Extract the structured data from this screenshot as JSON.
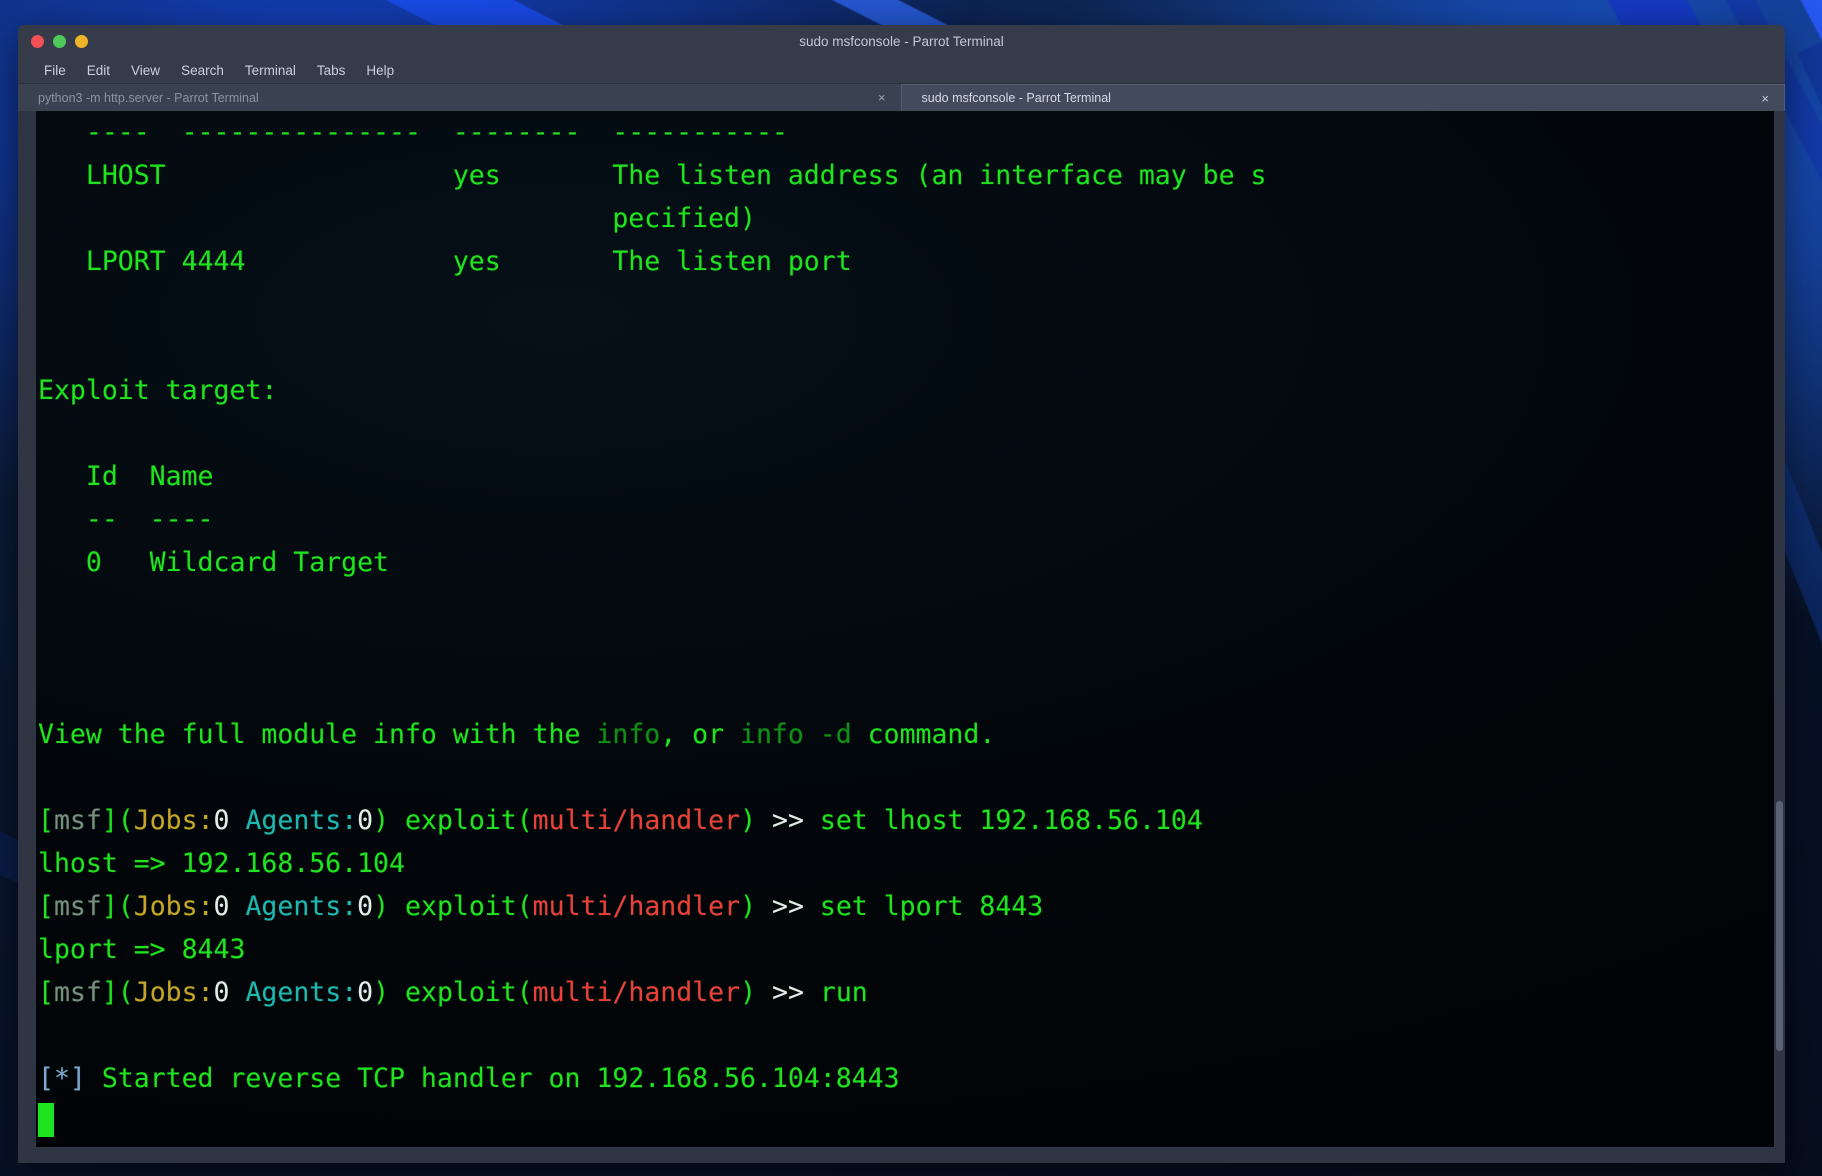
{
  "window": {
    "title": "sudo msfconsole - Parrot Terminal",
    "controls": {
      "close": "close-button",
      "minimize": "minimize-button",
      "maximize": "maximize-button"
    }
  },
  "menubar": {
    "items": [
      {
        "label": "File"
      },
      {
        "label": "Edit"
      },
      {
        "label": "View"
      },
      {
        "label": "Search"
      },
      {
        "label": "Terminal"
      },
      {
        "label": "Tabs"
      },
      {
        "label": "Help"
      }
    ]
  },
  "tabs": [
    {
      "label": "python3 -m http.server - Parrot Terminal",
      "active": false,
      "close": "×"
    },
    {
      "label": "sudo msfconsole - Parrot Terminal",
      "active": true,
      "close": "×"
    }
  ],
  "terminal": {
    "prompt": {
      "bracket_open": "[",
      "msf": "msf",
      "bracket_close": "]",
      "paren_open": "(",
      "jobs_label": "Jobs:",
      "jobs_value": "0",
      "agents_label": " Agents:",
      "agents_value": "0",
      "paren_close": ")",
      "module_prefix": " exploit(",
      "module_name": "multi/handler",
      "module_suffix": ")",
      "arrow": " >> "
    },
    "options_table": {
      "rule_name": "----",
      "rule_setting": "---------------",
      "rule_required": "--------",
      "rule_description": "-----------",
      "rows": [
        {
          "name": "LHOST",
          "setting": "",
          "required": "yes",
          "description": "The listen address (an interface may be s",
          "description_wrap": "pecified)"
        },
        {
          "name": "LPORT",
          "setting": "4444",
          "required": "yes",
          "description": "The listen port",
          "description_wrap": ""
        }
      ]
    },
    "exploit_target": {
      "heading": "Exploit target:",
      "header_id": "Id",
      "header_name": "Name",
      "rule_id": "--",
      "rule_name": "----",
      "row_id": "0",
      "row_name": "Wildcard Target"
    },
    "info_hint": {
      "part1": "View the full module info with the ",
      "cmd1": "info",
      "part2": ", or ",
      "cmd2": "info -d",
      "part3": " command."
    },
    "commands": [
      {
        "input": "set lhost 192.168.56.104",
        "output": "lhost => 192.168.56.104"
      },
      {
        "input": "set lport 8443",
        "output": "lport => 8443"
      },
      {
        "input": "run",
        "output": ""
      }
    ],
    "status_line": {
      "marker": "[*]",
      "text": " Started reverse TCP handler on 192.168.56.104:8443"
    },
    "cursor": "block-cursor"
  },
  "colors": {
    "green": "#1ee31e",
    "dim_green": "#0f8f16",
    "red": "#f23b3b",
    "yellow": "#c9a227",
    "cyan": "#1fb5b5",
    "white": "#e8eaec",
    "blue": "#7fa5d8",
    "terminal_bg": "#02060a",
    "chrome_bg": "#353b48"
  }
}
